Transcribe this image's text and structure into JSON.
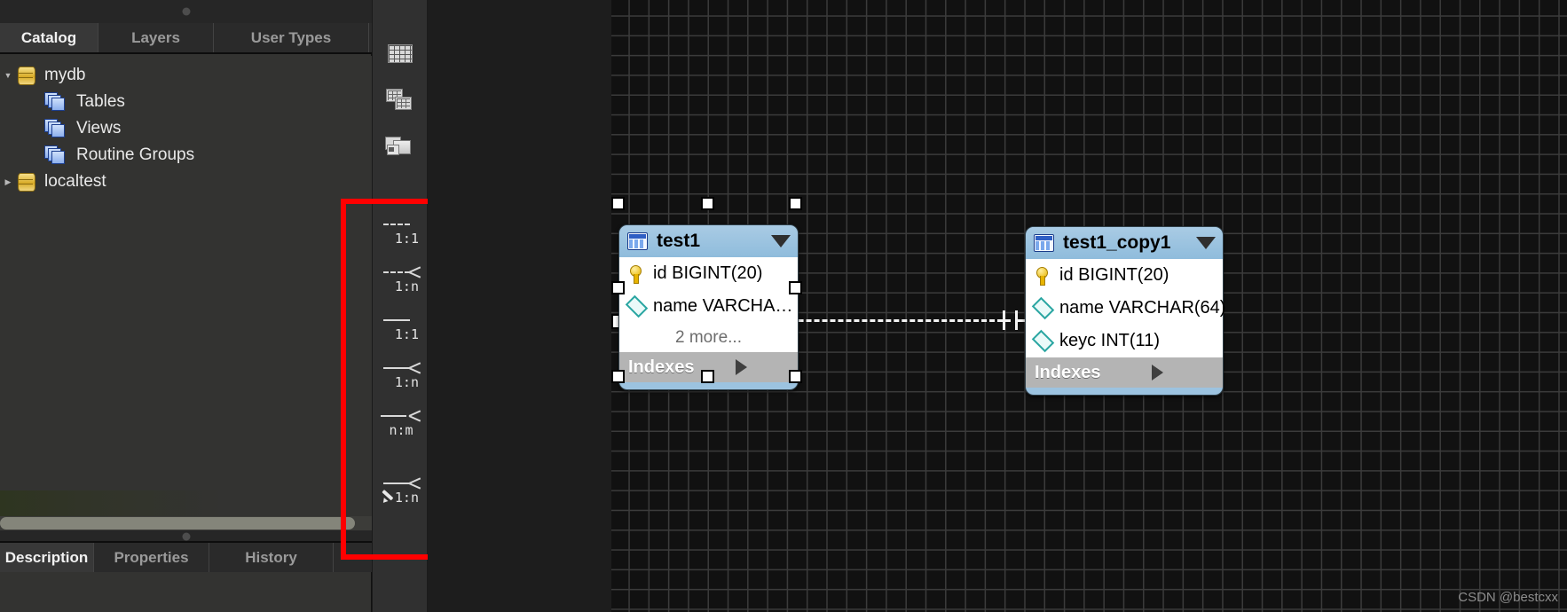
{
  "left_panel": {
    "top_tabs": [
      {
        "label": "Catalog",
        "active": true
      },
      {
        "label": "Layers",
        "active": false
      },
      {
        "label": "User Types",
        "active": false
      }
    ],
    "bottom_tabs": [
      {
        "label": "Description",
        "active": true
      },
      {
        "label": "Properties",
        "active": false
      },
      {
        "label": "History",
        "active": false
      }
    ],
    "tree": [
      {
        "label": "mydb",
        "icon": "database-icon",
        "expanded": true,
        "depth": 0
      },
      {
        "label": "Tables",
        "icon": "tables-icon",
        "depth": 1
      },
      {
        "label": "Views",
        "icon": "views-icon",
        "depth": 1
      },
      {
        "label": "Routine Groups",
        "icon": "routine-groups-icon",
        "depth": 1
      },
      {
        "label": "localtest",
        "icon": "database-icon",
        "expanded": false,
        "depth": 0
      }
    ]
  },
  "tool_strip": {
    "object_tools": [
      {
        "name": "new-table-tool",
        "icon": "table-grid-icon"
      },
      {
        "name": "new-view-tool",
        "icon": "two-tables-icon"
      },
      {
        "name": "new-routine-group-tool",
        "icon": "routine-group-icon"
      }
    ],
    "relationship_tools": [
      {
        "name": "place-1-to-1-non-identifying",
        "caption": "1:1",
        "style": "dashed",
        "crow": false
      },
      {
        "name": "place-1-to-n-non-identifying",
        "caption": "1:n",
        "style": "dashed",
        "crow": true
      },
      {
        "name": "place-1-to-1-identifying",
        "caption": "1:1",
        "style": "solid",
        "crow": false
      },
      {
        "name": "place-1-to-n-identifying",
        "caption": "1:n",
        "style": "solid",
        "crow": true
      },
      {
        "name": "place-n-to-m-identifying",
        "caption": "n:m",
        "style": "solid",
        "crow": true,
        "crow_left": true
      },
      {
        "name": "place-relationship-using-existing-columns",
        "caption": "1:n",
        "style": "solid",
        "crow": true,
        "pencil": true
      }
    ]
  },
  "canvas": {
    "tables": [
      {
        "name": "test1",
        "selected": true,
        "columns": [
          {
            "label": "id BIGINT(20)",
            "key": "primary"
          },
          {
            "label": "name VARCHA…",
            "key": "index"
          }
        ],
        "more_label": "2 more...",
        "indexes_label": "Indexes"
      },
      {
        "name": "test1_copy1",
        "selected": false,
        "columns": [
          {
            "label": "id BIGINT(20)",
            "key": "primary"
          },
          {
            "label": "name VARCHAR(64)",
            "key": "index"
          },
          {
            "label": "keyc INT(11)",
            "key": "index"
          }
        ],
        "more_label": "",
        "indexes_label": "Indexes"
      }
    ],
    "relationship": {
      "name": "relationship-test1-to-test1_copy1",
      "style": "dashed",
      "left_end": "crow-foot-many",
      "right_end": "one-and-only-one"
    }
  },
  "watermark": "CSDN @bestcxx",
  "colors": {
    "accent_red": "#ff0000",
    "table_header": "#9cc3e0",
    "panel_bg": "#333331",
    "canvas_bg": "#111111"
  }
}
